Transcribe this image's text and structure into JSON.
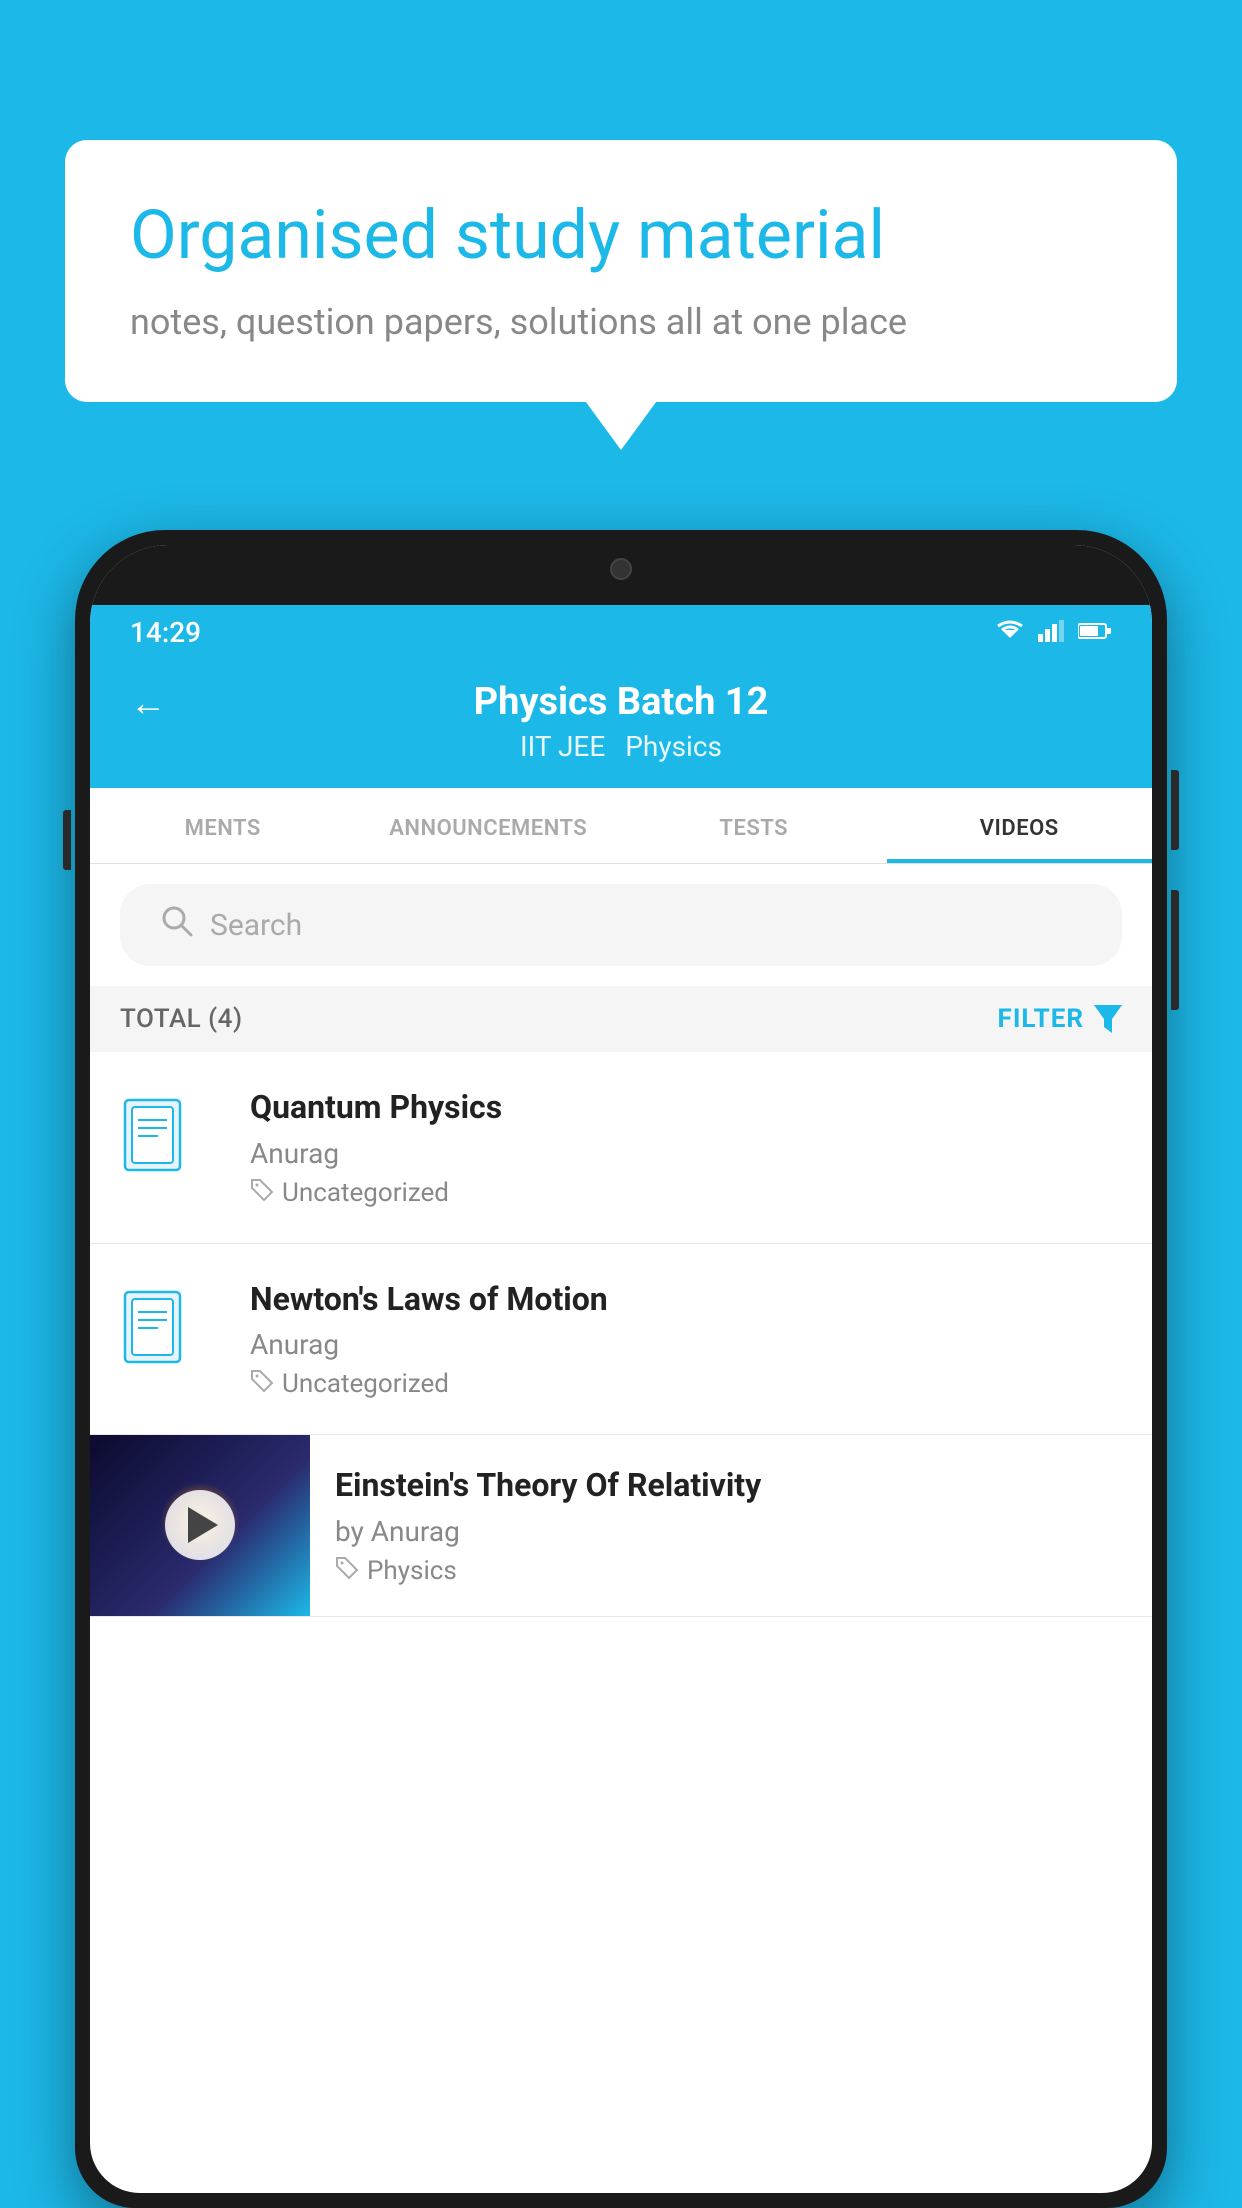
{
  "bubble": {
    "title": "Organised study material",
    "subtitle": "notes, question papers, solutions all at one place"
  },
  "status_bar": {
    "time": "14:29",
    "wifi": "▼",
    "signal": "▲",
    "battery": "▮"
  },
  "header": {
    "title": "Physics Batch 12",
    "tag1": "IIT JEE",
    "tag2": "Physics",
    "back_label": "←"
  },
  "tabs": [
    {
      "label": "MENTS",
      "active": false
    },
    {
      "label": "ANNOUNCEMENTS",
      "active": false
    },
    {
      "label": "TESTS",
      "active": false
    },
    {
      "label": "VIDEOS",
      "active": true
    }
  ],
  "search": {
    "placeholder": "Search"
  },
  "filter": {
    "total_label": "TOTAL (4)",
    "filter_label": "FILTER"
  },
  "videos": [
    {
      "title": "Quantum Physics",
      "author": "Anurag",
      "tag": "Uncategorized",
      "has_thumb": false
    },
    {
      "title": "Newton's Laws of Motion",
      "author": "Anurag",
      "tag": "Uncategorized",
      "has_thumb": false
    },
    {
      "title": "Einstein's Theory Of Relativity",
      "author": "by Anurag",
      "tag": "Physics",
      "has_thumb": true
    }
  ],
  "colors": {
    "primary": "#1cb8e8",
    "text_dark": "#222222",
    "text_gray": "#888888",
    "tab_active": "#333333"
  }
}
